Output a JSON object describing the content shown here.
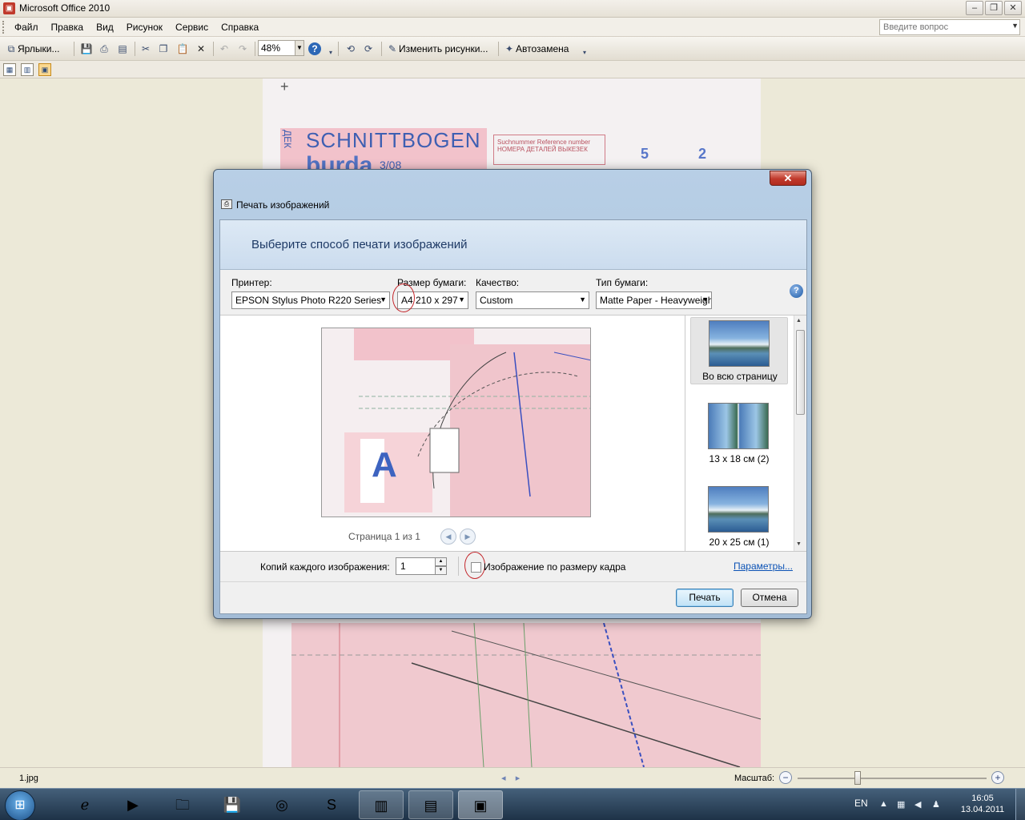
{
  "window": {
    "title": "Microsoft Office 2010",
    "controls": {
      "minimize": "–",
      "restore": "❐",
      "close": "✕"
    }
  },
  "menu": {
    "items": [
      "Файл",
      "Правка",
      "Вид",
      "Рисунок",
      "Сервис",
      "Справка"
    ],
    "help_placeholder": "Введите вопрос"
  },
  "toolbar": {
    "shortcuts_label": "Ярлыки...",
    "zoom_value": "48%",
    "edit_pictures_label": "Изменить рисунки...",
    "autocorrect_label": "Автозамена"
  },
  "document": {
    "brand": "SCHNITTBOGEN",
    "brand_sub": "burda",
    "issue": "3/08",
    "numbers": [
      "5",
      "2"
    ],
    "sheet_side_label": "ДЕК",
    "ref_box": "Suchnummer\nReference number\nНОМЕРА ДЕТАЛЕЙ ВЫКЕЗЕК"
  },
  "dialog": {
    "title": "Печать изображений",
    "close_label": "✕",
    "heading": "Выберите способ печати изображений",
    "printer_label": "Принтер:",
    "printer_value": "EPSON Stylus Photo R220 Series",
    "paper_size_label": "Размер бумаги:",
    "paper_size_value": "A4 210 x 297",
    "quality_label": "Качество:",
    "quality_value": "Custom",
    "paper_type_label": "Тип бумаги:",
    "paper_type_value": "Matte Paper - Heavyweight",
    "help_icon": "?",
    "pager_text": "Страница 1 из 1",
    "layouts": [
      {
        "caption": "Во всю страницу",
        "selected": true
      },
      {
        "caption": "13 x 18 см (2)",
        "selected": false
      },
      {
        "caption": "20 x 25 см (1)",
        "selected": false
      }
    ],
    "copies_label": "Копий каждого изображения:",
    "copies_value": "1",
    "fit_label": "Изображение по размеру кадра",
    "fit_checked": false,
    "params_link": "Параметры...",
    "print_button": "Печать",
    "cancel_button": "Отмена"
  },
  "statusbar": {
    "filename": "1.jpg",
    "zoom_label": "Масштаб:"
  },
  "taskbar": {
    "language": "EN",
    "time": "16:05",
    "date": "13.04.2011"
  },
  "colors": {
    "accent_red": "#c3262b",
    "link": "#0b52b5",
    "pattern_pink": "#f0c9cf",
    "pattern_blue": "#3e5fb2"
  }
}
